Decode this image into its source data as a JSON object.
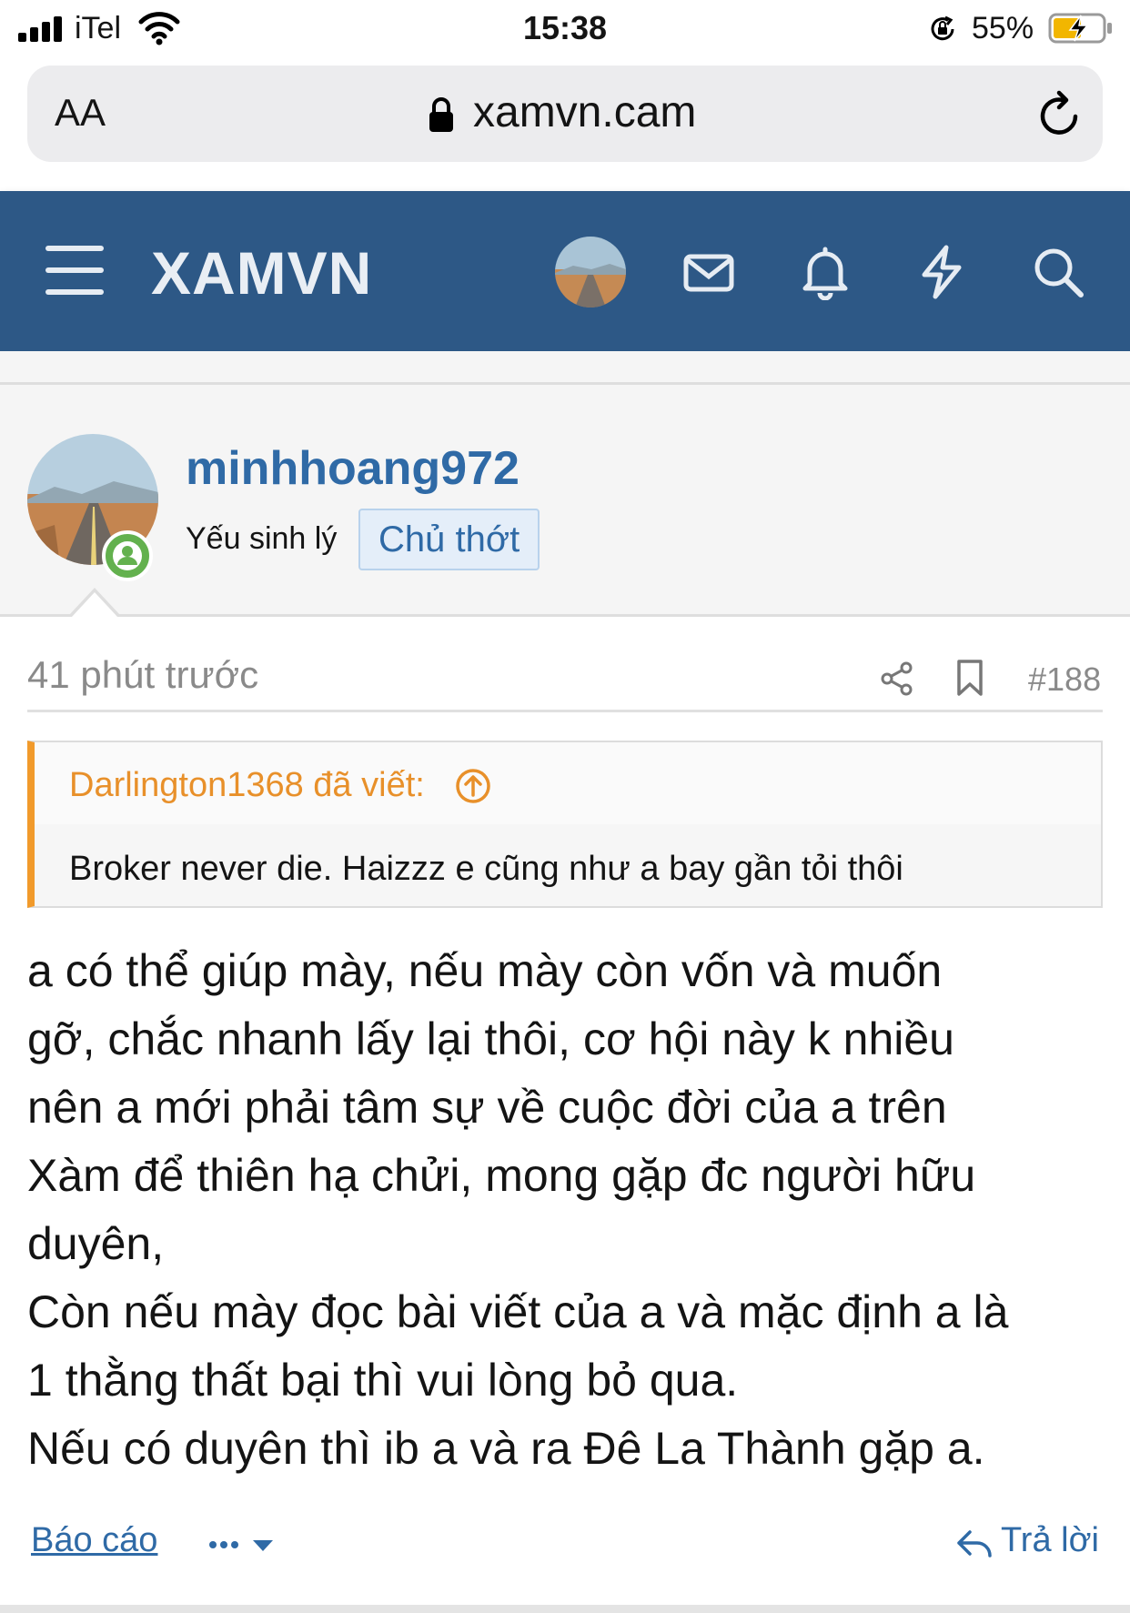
{
  "status_bar": {
    "carrier": "iTel",
    "time": "15:38",
    "battery": "55%"
  },
  "browser": {
    "text_size_label": "AA",
    "url": "xamvn.cam"
  },
  "nav": {
    "logo": "XAMVN",
    "colors": {
      "header_bg": "#2d5886",
      "icon": "#e6ecf3"
    }
  },
  "post": {
    "username": "minhhoang972",
    "user_title": "Yếu sinh lý",
    "badge": "Chủ thớt",
    "time": "41 phút trước",
    "post_number": "#188",
    "quote": {
      "author": "Darlington1368 đã viết:",
      "text": "Broker never die. Haizzz e cũng như a bay gần tỏi thôi"
    },
    "body_lines": [
      "a có thể giúp mày, nếu mày còn vốn và muốn",
      "gỡ, chắc nhanh lấy lại thôi, cơ hội này k nhiều",
      "nên a mới phải tâm sự về cuộc đời của a trên",
      "Xàm để thiên hạ chửi, mong gặp đc người hữu",
      "duyên,",
      "Còn nếu mày đọc bài viết của a và mặc định a là",
      "1 thằng thất bại thì vui lòng bỏ qua.",
      "Nếu có duyên thì ib a và ra Đê La Thành gặp a."
    ],
    "actions": {
      "report": "Báo cáo",
      "reply": "Trả lời"
    }
  }
}
